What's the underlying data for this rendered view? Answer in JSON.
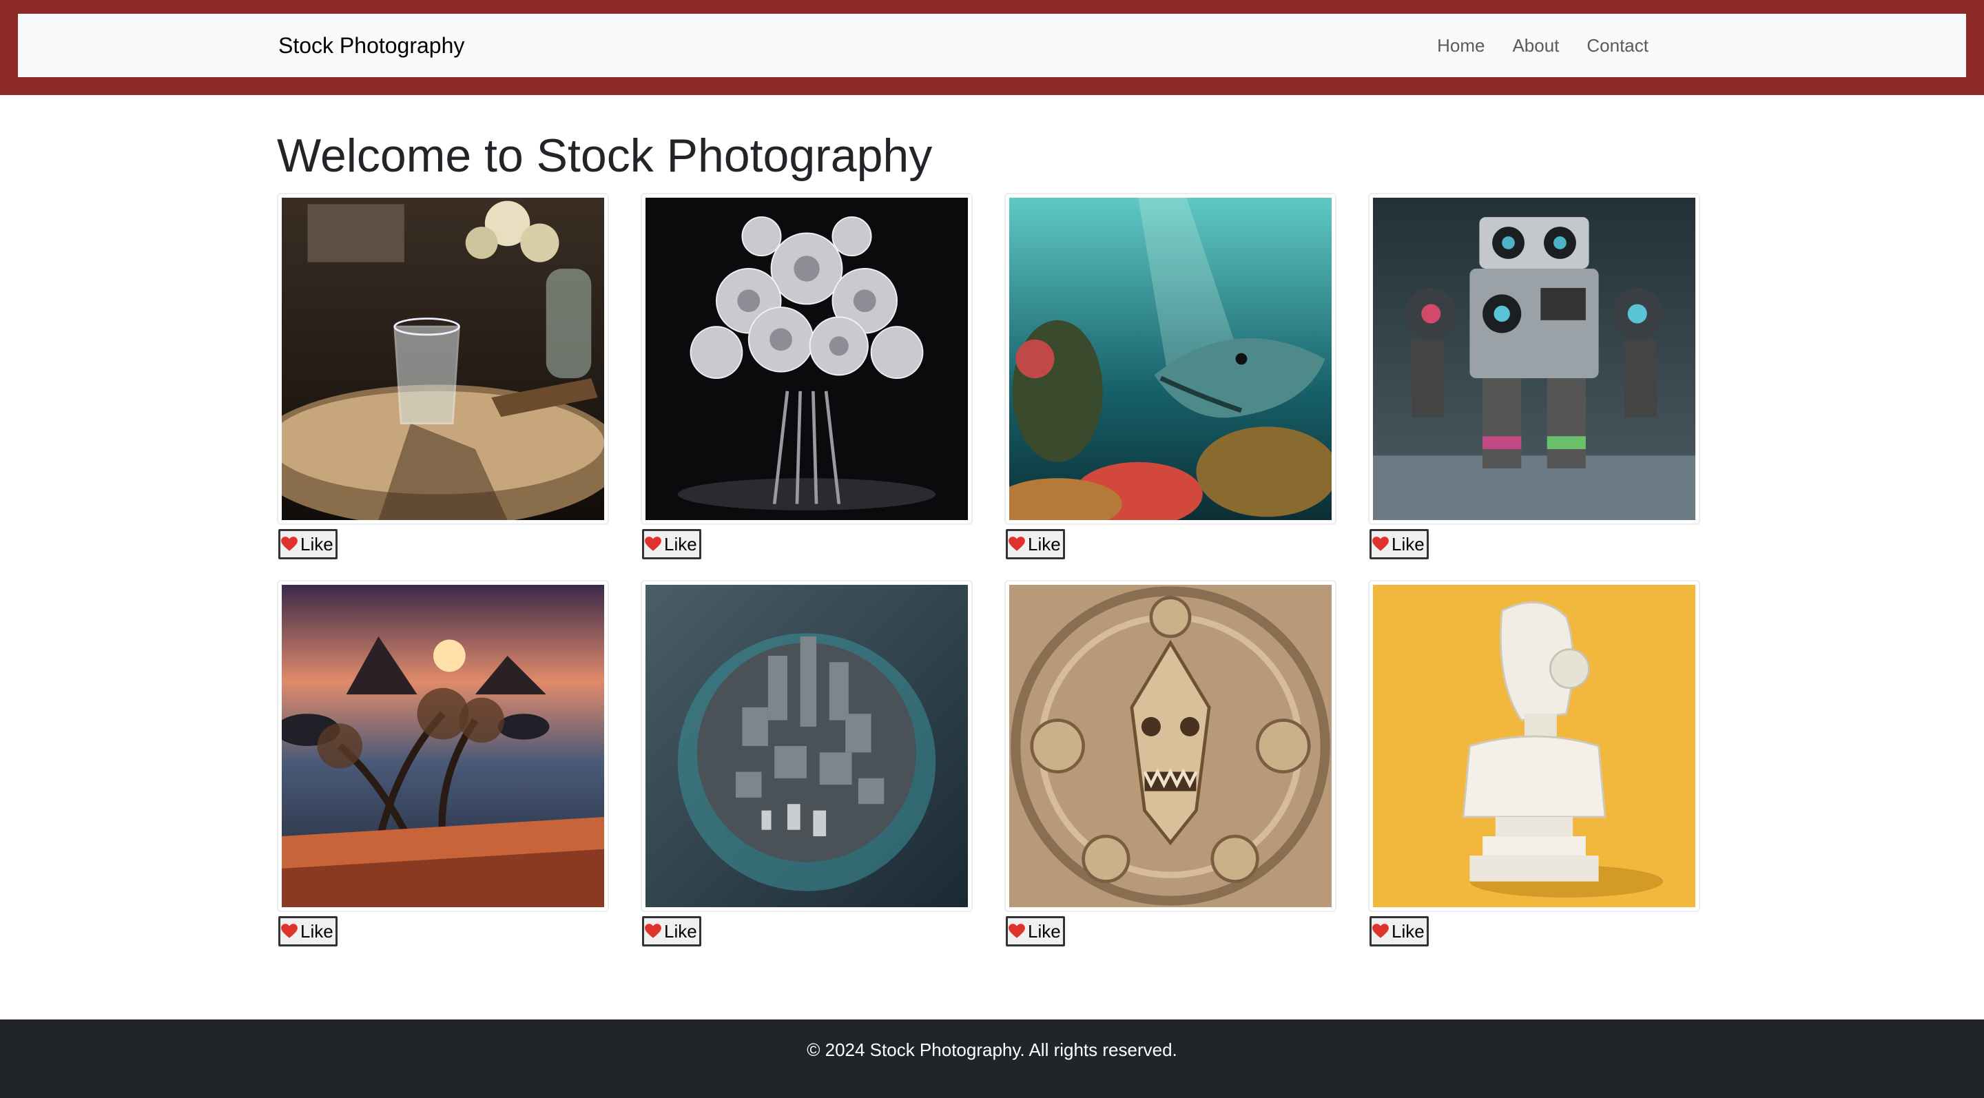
{
  "navbar": {
    "brand": "Stock Photography",
    "links": [
      {
        "label": "Home"
      },
      {
        "label": "About"
      },
      {
        "label": "Contact"
      }
    ]
  },
  "main": {
    "title": "Welcome to Stock Photography",
    "like_label": "Like",
    "photos": [
      {
        "subject": "glass on wooden table with flowers"
      },
      {
        "subject": "silver crystal rose bouquet"
      },
      {
        "subject": "underwater reef with large fish"
      },
      {
        "subject": "robot made of boombox speakers"
      },
      {
        "subject": "sunset over islands with trees"
      },
      {
        "subject": "aerial city on circular island"
      },
      {
        "subject": "carved wooden dragon mask ornament"
      },
      {
        "subject": "white robot bust on yellow background"
      }
    ]
  },
  "footer": {
    "text": "© 2024 Stock Photography. All rights reserved."
  },
  "colors": {
    "header_band": "#8b2a26",
    "navbar_bg": "#f8f9fa",
    "footer_bg": "#212529",
    "heart": "#e0322d"
  },
  "icons": {
    "like": "heart-icon"
  }
}
